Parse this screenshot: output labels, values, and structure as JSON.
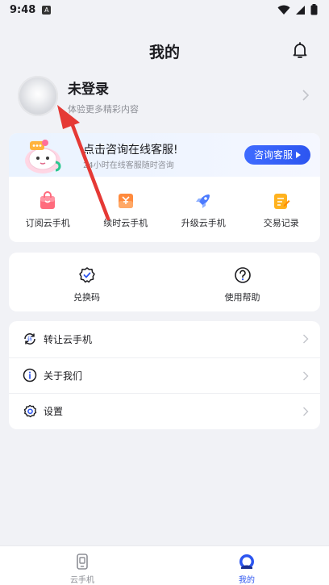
{
  "status_bar": {
    "time": "9:48",
    "badge": "A"
  },
  "header": {
    "title": "我的"
  },
  "profile": {
    "name": "未登录",
    "subtitle": "体验更多精彩内容"
  },
  "banner": {
    "title": "点击咨询在线客服!",
    "desc": "24小时在线客服随时咨询",
    "button": "咨询客服"
  },
  "quick_actions": [
    {
      "label": "订阅云手机",
      "icon": "subscribe-bag-icon"
    },
    {
      "label": "续时云手机",
      "icon": "renew-coupon-icon"
    },
    {
      "label": "升级云手机",
      "icon": "upgrade-rocket-icon"
    },
    {
      "label": "交易记录",
      "icon": "transaction-record-icon"
    }
  ],
  "tools": [
    {
      "label": "兑换码",
      "icon": "redeem-code-icon"
    },
    {
      "label": "使用帮助",
      "icon": "help-question-icon"
    }
  ],
  "menu": [
    {
      "label": "转让云手机",
      "icon": "transfer-icon"
    },
    {
      "label": "关于我们",
      "icon": "info-icon"
    },
    {
      "label": "设置",
      "icon": "settings-gear-icon"
    }
  ],
  "tabbar": [
    {
      "label": "云手机",
      "active": false
    },
    {
      "label": "我的",
      "active": true
    }
  ],
  "colors": {
    "accent": "#2c55f0",
    "annotation_arrow": "#e53935",
    "background": "#f1f2f6"
  }
}
